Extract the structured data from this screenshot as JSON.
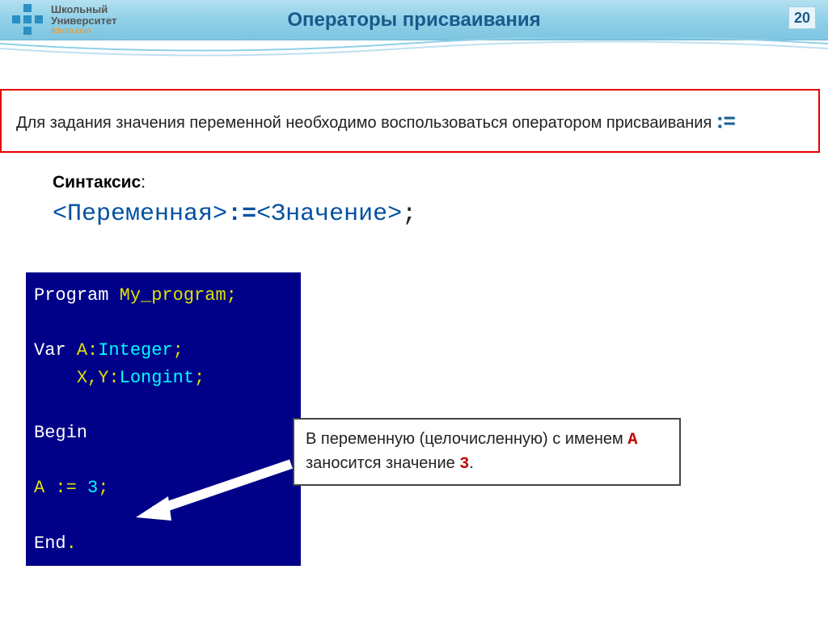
{
  "header": {
    "logo_main": "Школьный",
    "logo_sub": "Университет",
    "logo_url": "itdrom.com",
    "title": "Операторы присваивания",
    "page_number": "20"
  },
  "definition": {
    "text_before": "Для задания значения переменной необходимо воспользоваться оператором присваивания ",
    "operator": ":="
  },
  "syntax": {
    "label": "Синтаксис",
    "colon": ":",
    "variable": "Переменная",
    "operator": ":=",
    "value": "Значение",
    "semicolon": ";"
  },
  "code": {
    "kw_program": "Program",
    "prog_name": "My_program",
    "kw_var": "Var",
    "decl_a": "A",
    "type_int": "Integer",
    "decl_xy": "X,Y",
    "type_long": "Longint",
    "kw_begin": "Begin",
    "assign_lhs": "A",
    "assign_op": ":=",
    "assign_rhs": "3",
    "kw_end": "End",
    "dot": ".",
    "semi": ";",
    "colon": ":"
  },
  "callout": {
    "t1": "В переменную (целочисленную) с именем ",
    "var": "A",
    "t2": " заносится значение ",
    "val": "3",
    "t3": "."
  }
}
